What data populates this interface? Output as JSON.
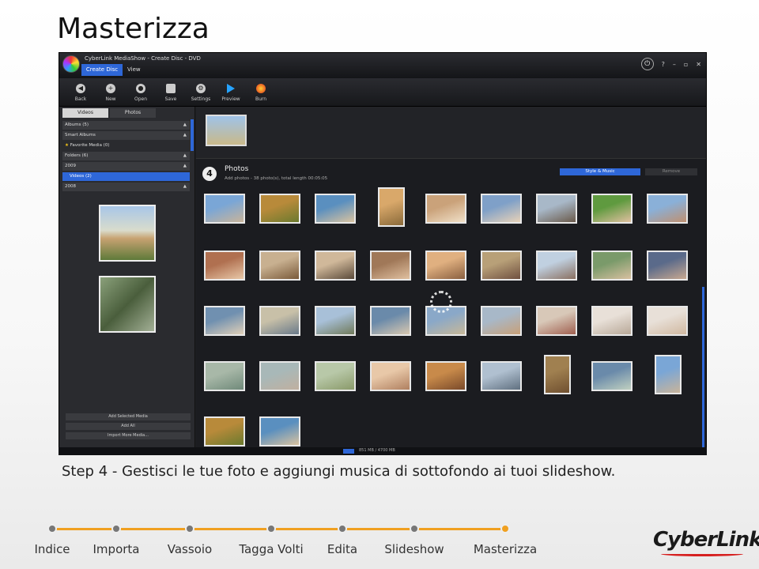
{
  "slide": {
    "title": "Masterizza",
    "caption": "Step 4 - Gestisci le tue foto e aggiungi musica di sottofondo ai tuoi slideshow."
  },
  "app": {
    "window_title": "CyberLink MediaShow - Create Disc - DVD",
    "tabs": [
      "Create Disc",
      "View"
    ],
    "window_controls": [
      "?",
      "–",
      "▫",
      "✕"
    ],
    "toolbar": [
      {
        "label": "Back",
        "icon": "back-icon"
      },
      {
        "label": "New",
        "icon": "new-icon"
      },
      {
        "label": "Open",
        "icon": "open-icon"
      },
      {
        "label": "Save",
        "icon": "save-icon"
      },
      {
        "label": "Settings",
        "icon": "gear-icon"
      },
      {
        "label": "Preview",
        "icon": "play-icon"
      },
      {
        "label": "Burn",
        "icon": "burn-icon"
      }
    ],
    "left_panel": {
      "tabs": [
        "Videos",
        "Photos"
      ],
      "tree": [
        "Albums (5)",
        "Smart Albums",
        "Favorite Media (0)",
        "Folders (6)",
        "2009",
        "Videos (2)",
        "2008"
      ],
      "buttons": [
        "Add Selected Media",
        "Add All",
        "Import More Media..."
      ]
    },
    "section": {
      "number": "4",
      "title": "Photos",
      "subtitle": "Add photos - 38 photo(s), total length 00:05:05",
      "style_button": "Style & Music",
      "remove_button": "Remove"
    },
    "status": "851 MB / 4700 MB",
    "accent_color": "#2e67d8"
  },
  "nav": {
    "items": [
      "Indice",
      "Importa",
      "Vassoio",
      "Tagga Volti",
      "Edita",
      "Slideshow",
      "Masterizza"
    ],
    "active": "Masterizza"
  },
  "brand": "CyberLink"
}
